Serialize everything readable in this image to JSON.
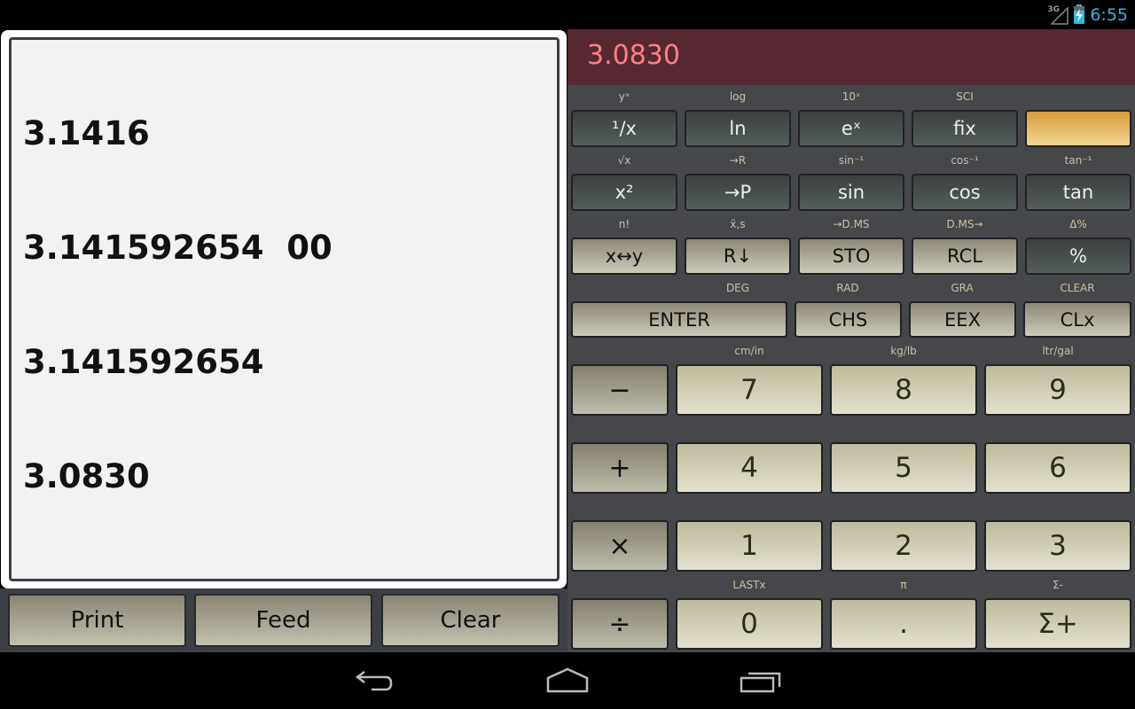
{
  "status_bar": {
    "network": "3G",
    "clock": "6:55"
  },
  "printer": {
    "tape_lines": [
      "3.1416",
      "3.141592654  00",
      "3.141592654",
      "3.0830"
    ],
    "buttons": {
      "print": "Print",
      "feed": "Feed",
      "clear": "Clear"
    }
  },
  "calculator": {
    "display": "3.0830",
    "rows": [
      {
        "labels": [
          "yˣ",
          "log",
          "10ˣ",
          "SCI",
          ""
        ],
        "keys": [
          "¹/x",
          "ln",
          "eˣ",
          "fix",
          ""
        ]
      },
      {
        "labels": [
          "√x",
          "→R",
          "sin⁻¹",
          "cos⁻¹",
          "tan⁻¹"
        ],
        "keys": [
          "x²",
          "→P",
          "sin",
          "cos",
          "tan"
        ]
      },
      {
        "labels": [
          "n!",
          "x̄,s",
          "→D.MS",
          "D.MS→",
          "Δ%"
        ],
        "keys": [
          "x↔y",
          "R↓",
          "STO",
          "RCL",
          "%"
        ]
      },
      {
        "labels": [
          "DEG",
          "RAD",
          "GRA",
          "CLEAR"
        ],
        "keys": [
          "ENTER",
          "CHS",
          "EEX",
          "CLx"
        ]
      }
    ],
    "numpad": [
      {
        "labels": [
          "",
          "cm/in",
          "kg/lb",
          "ltr/gal"
        ],
        "keys": [
          "−",
          "7",
          "8",
          "9"
        ]
      },
      {
        "labels": [
          "",
          "",
          "",
          ""
        ],
        "keys": [
          "+",
          "4",
          "5",
          "6"
        ]
      },
      {
        "labels": [
          "",
          "",
          "",
          ""
        ],
        "keys": [
          "×",
          "1",
          "2",
          "3"
        ]
      },
      {
        "labels": [
          "",
          "LASTx",
          "π",
          "Σ-"
        ],
        "keys": [
          "÷",
          "0",
          ".",
          "Σ+"
        ]
      }
    ]
  },
  "nav_bar": {
    "back": "back-icon",
    "home": "home-icon",
    "recents": "recent-apps-icon"
  }
}
